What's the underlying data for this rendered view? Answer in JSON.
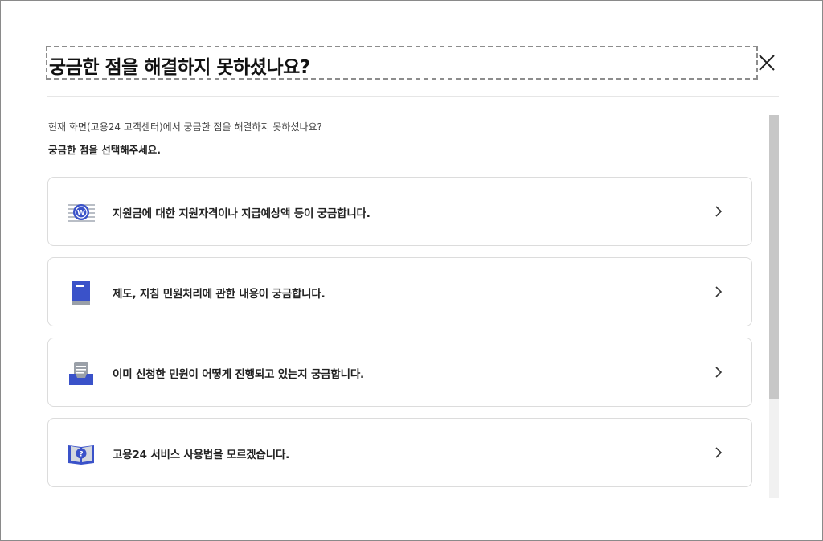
{
  "dialog": {
    "title": "궁금한 점을 해결하지 못하셨나요?",
    "close_label": "닫기"
  },
  "intro": {
    "line1": "현재 화면(고용24 고객센터)에서 궁금한 점을 해결하지 못하셨나요?",
    "line2": "궁금한 점을 선택해주세요."
  },
  "options": [
    {
      "label": "지원금에 대한 지원자격이나 지급예상액 등이 궁금합니다.",
      "icon": "money-coin-icon"
    },
    {
      "label": "제도, 지침 민원처리에 관한 내용이 궁금합니다.",
      "icon": "book-icon"
    },
    {
      "label": "이미 신청한 민원이 어떻게 진행되고 있는지 궁금합니다.",
      "icon": "document-tray-icon"
    },
    {
      "label": "고용24 서비스 사용법을 모르겠습니다.",
      "icon": "help-book-icon"
    }
  ],
  "colors": {
    "accent_blue": "#3a52c9",
    "icon_gray": "#9aa0a8",
    "border": "#dcdcdc"
  }
}
